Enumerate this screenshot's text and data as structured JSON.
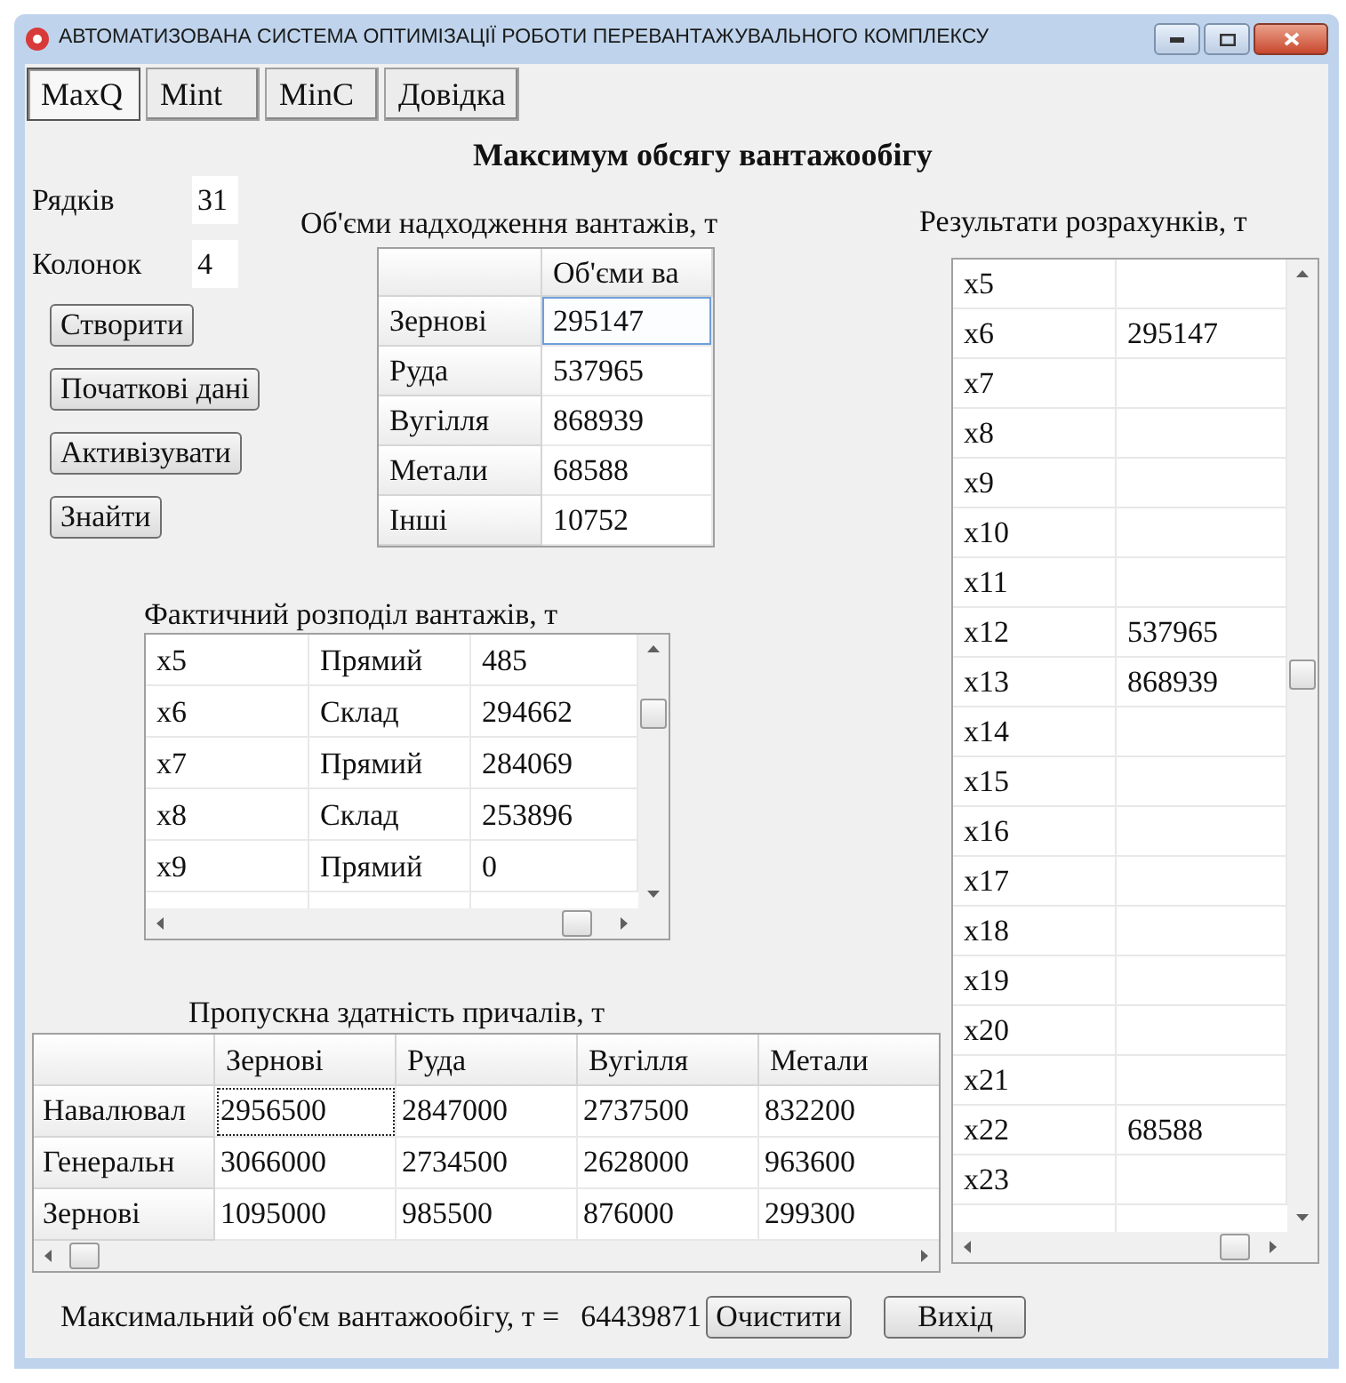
{
  "window": {
    "title": "АВТОМАТИЗОВАНА СИСТЕМА ОПТИМІЗАЦІЇ РОБОТИ ПЕРЕВАНТАЖУВАЛЬНОГО КОМПЛЕКСУ"
  },
  "tabs": [
    {
      "label": "MaxQ",
      "selected": true
    },
    {
      "label": "Mint",
      "selected": false
    },
    {
      "label": "MinC",
      "selected": false
    },
    {
      "label": "Довідка",
      "selected": false
    }
  ],
  "heading": "Максимум обсягу вантажообігу",
  "fields": [
    {
      "label": "Рядків",
      "value": "31"
    },
    {
      "label": "Колонок",
      "value": "4"
    }
  ],
  "actions": [
    "Створити",
    "Початкові дані",
    "Активізувати",
    "Знайти"
  ],
  "supply": {
    "caption": "Об'єми надходження вантажів, т",
    "header": "Об'єми ва",
    "rows": [
      {
        "name": "Зернові",
        "value": "295147",
        "selected": true
      },
      {
        "name": "Руда",
        "value": "537965",
        "selected": false
      },
      {
        "name": "Вугілля",
        "value": "868939",
        "selected": false
      },
      {
        "name": "Метали",
        "value": "68588",
        "selected": false
      },
      {
        "name": "Інші",
        "value": "10752",
        "selected": false
      }
    ]
  },
  "distribution": {
    "caption": "Фактичний розподіл вантажів, т",
    "rows": [
      {
        "var": "x5",
        "mode": "Прямий",
        "value": "485"
      },
      {
        "var": "x6",
        "mode": "Склад",
        "value": "294662"
      },
      {
        "var": "x7",
        "mode": "Прямий",
        "value": "284069"
      },
      {
        "var": "x8",
        "mode": "Склад",
        "value": "253896"
      },
      {
        "var": "x9",
        "mode": "Прямий",
        "value": "0"
      }
    ]
  },
  "capacity": {
    "caption": "Пропускна здатність причалів, т",
    "columns": [
      "Зернові",
      "Руда",
      "Вугілля",
      "Метали"
    ],
    "rows": [
      {
        "name": "Навалювал",
        "values": [
          "2956500",
          "2847000",
          "2737500",
          "832200"
        ],
        "selected": true
      },
      {
        "name": "Генеральн",
        "values": [
          "3066000",
          "2734500",
          "2628000",
          "963600"
        ],
        "selected": false
      },
      {
        "name": "Зернові",
        "values": [
          "1095000",
          "985500",
          "876000",
          "299300"
        ],
        "selected": false
      }
    ]
  },
  "results": {
    "caption": "Результати розрахунків, т",
    "rows": [
      {
        "var": "x5"
      },
      {
        "var": "x6",
        "value": "295147"
      },
      {
        "var": "x7"
      },
      {
        "var": "x8"
      },
      {
        "var": "x9"
      },
      {
        "var": "x10"
      },
      {
        "var": "x11"
      },
      {
        "var": "x12",
        "value": "537965"
      },
      {
        "var": "x13",
        "value": "868939"
      },
      {
        "var": "x14"
      },
      {
        "var": "x15"
      },
      {
        "var": "x16"
      },
      {
        "var": "x17"
      },
      {
        "var": "x18"
      },
      {
        "var": "x19"
      },
      {
        "var": "x20"
      },
      {
        "var": "x21"
      },
      {
        "var": "x22",
        "value": "68588"
      },
      {
        "var": "x23"
      }
    ]
  },
  "total": {
    "label": "Максимальний об'єм вантажообігу, т =",
    "value": "64439871"
  },
  "footer_buttons": [
    "Очистити",
    "Вихід"
  ]
}
